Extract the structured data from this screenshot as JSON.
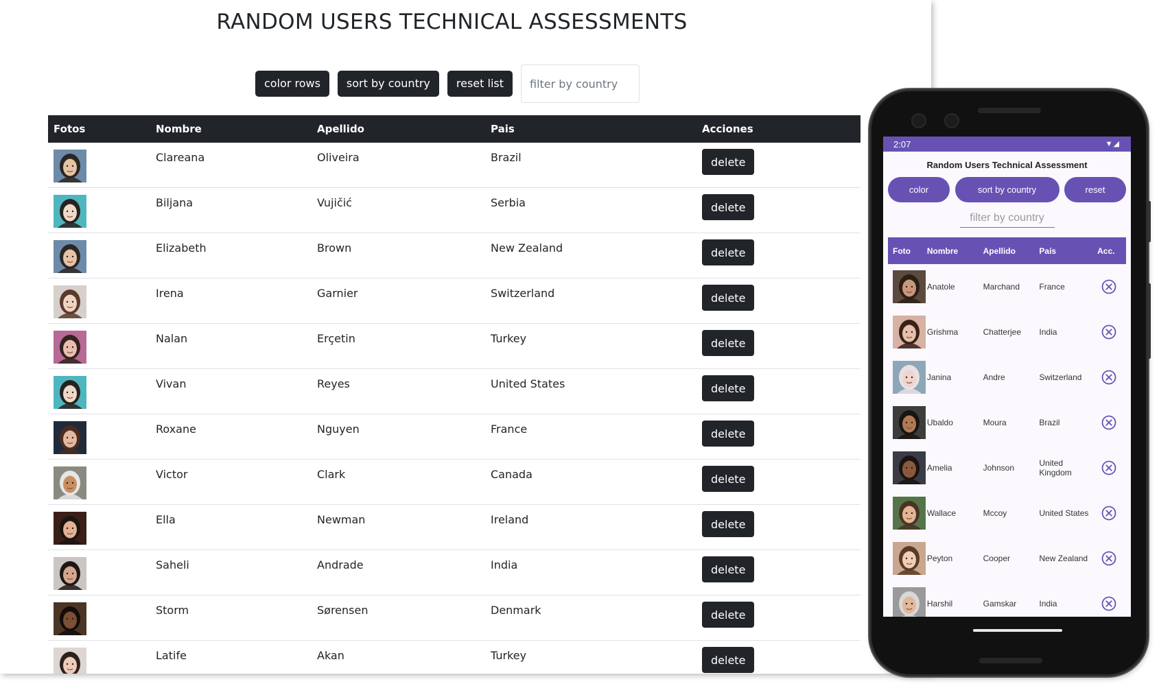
{
  "web": {
    "title": "RANDOM USERS TECHNICAL ASSESSMENTS",
    "buttons": {
      "color": "color rows",
      "sort": "sort by country",
      "reset": "reset list"
    },
    "filter_placeholder": "filter by country",
    "headers": [
      "Fotos",
      "Nombre",
      "Apellido",
      "Pais",
      "Acciones"
    ],
    "delete_label": "delete",
    "rows": [
      {
        "first": "Clareana",
        "last": "Oliveira",
        "country": "Brazil",
        "bg": "#6d8aa8",
        "skin": "#e4c3a6",
        "hair": "#2b2622"
      },
      {
        "first": "Biljana",
        "last": "Vujičić",
        "country": "Serbia",
        "bg": "#4fb6c0",
        "skin": "#efd9c8",
        "hair": "#272220"
      },
      {
        "first": "Elizabeth",
        "last": "Brown",
        "country": "New Zealand",
        "bg": "#6d8aa8",
        "skin": "#e4c3a6",
        "hair": "#2b2622"
      },
      {
        "first": "Irena",
        "last": "Garnier",
        "country": "Switzerland",
        "bg": "#d7cfcb",
        "skin": "#f0d4c3",
        "hair": "#5a3a2a"
      },
      {
        "first": "Nalan",
        "last": "Erçetin",
        "country": "Turkey",
        "bg": "#b66a95",
        "skin": "#e8bfb0",
        "hair": "#33221f"
      },
      {
        "first": "Vivan",
        "last": "Reyes",
        "country": "United States",
        "bg": "#4fb6c0",
        "skin": "#efd9c8",
        "hair": "#272220"
      },
      {
        "first": "Roxane",
        "last": "Nguyen",
        "country": "France",
        "bg": "#202a3a",
        "skin": "#e2b8a0",
        "hair": "#4a2d20"
      },
      {
        "first": "Victor",
        "last": "Clark",
        "country": "Canada",
        "bg": "#8a8a80",
        "skin": "#c79063",
        "hair": "#e6e6e6"
      },
      {
        "first": "Ella",
        "last": "Newman",
        "country": "Ireland",
        "bg": "#3a1f16",
        "skin": "#e2b194",
        "hair": "#1e1410"
      },
      {
        "first": "Saheli",
        "last": "Andrade",
        "country": "India",
        "bg": "#c9c6c4",
        "skin": "#d3a88c",
        "hair": "#1d1716"
      },
      {
        "first": "Storm",
        "last": "Sørensen",
        "country": "Denmark",
        "bg": "#4b3525",
        "skin": "#7a4f34",
        "hair": "#140d0a"
      },
      {
        "first": "Latife",
        "last": "Akan",
        "country": "Turkey",
        "bg": "#ddd6d2",
        "skin": "#edcdb9",
        "hair": "#2e211c"
      }
    ]
  },
  "mobile": {
    "time": "2:07",
    "status_icons": "▼◢",
    "title": "Random Users Technical Assessment",
    "buttons": {
      "color": "color",
      "sort": "sort by country",
      "reset": "reset"
    },
    "filter_placeholder": "filter by country",
    "headers": [
      "Foto",
      "Nombre",
      "Apellido",
      "País",
      "Acc."
    ],
    "accent": "#6752b4",
    "rows": [
      {
        "first": "Anatole",
        "last": "Marchand",
        "country": "France",
        "bg": "#5b4a3d",
        "skin": "#c7987a",
        "hair": "#2a1f18"
      },
      {
        "first": "Grishma",
        "last": "Chatterjee",
        "country": "India",
        "bg": "#d7b1a3",
        "skin": "#e6c0ad",
        "hair": "#3a2118"
      },
      {
        "first": "Janina",
        "last": "Andre",
        "country": "Switzerland",
        "bg": "#8ea7b8",
        "skin": "#eed6cf",
        "hair": "#e9e1e3"
      },
      {
        "first": "Ubaldo",
        "last": "Moura",
        "country": "Brazil",
        "bg": "#3d3d3d",
        "skin": "#b07a56",
        "hair": "#1a1410"
      },
      {
        "first": "Amelia",
        "last": "Johnson",
        "country": "United Kingdom",
        "bg": "#3b3b45",
        "skin": "#8b5a3c",
        "hair": "#1a1412"
      },
      {
        "first": "Wallace",
        "last": "Mccoy",
        "country": "United States",
        "bg": "#55744a",
        "skin": "#e3b595",
        "hair": "#4a3324"
      },
      {
        "first": "Peyton",
        "last": "Cooper",
        "country": "New Zealand",
        "bg": "#c8a690",
        "skin": "#f0cdb5",
        "hair": "#5b3a25"
      },
      {
        "first": "Harshil",
        "last": "Gamskar",
        "country": "India",
        "bg": "#9a9a9a",
        "skin": "#e2b79c",
        "hair": "#d8d8d8"
      }
    ]
  }
}
